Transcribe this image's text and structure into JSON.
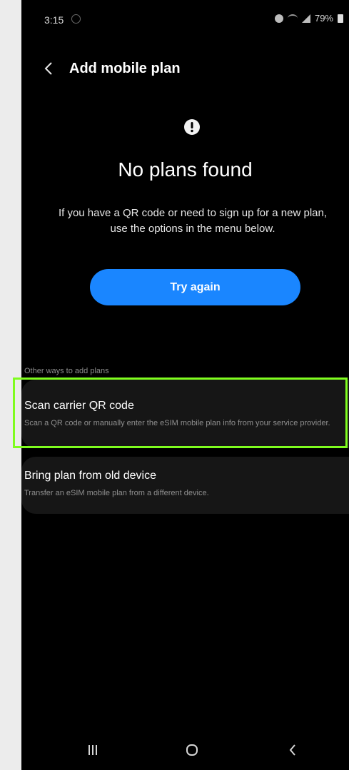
{
  "status_bar": {
    "time": "3:15",
    "battery": "79%"
  },
  "header": {
    "title": "Add mobile plan"
  },
  "main": {
    "headline": "No plans found",
    "description": "If you have a QR code or need to sign up for a new plan, use the options in the menu below.",
    "try_again_label": "Try again"
  },
  "other_ways": {
    "label": "Other ways to add plans",
    "items": [
      {
        "title": "Scan carrier QR code",
        "subtitle": "Scan a QR code or manually enter the eSIM mobile plan info from your service provider."
      },
      {
        "title": "Bring plan from old device",
        "subtitle": "Transfer an eSIM mobile plan from a different device."
      }
    ]
  },
  "colors": {
    "accent": "#1a86ff",
    "highlight": "#7ffc1f",
    "background": "#000000"
  },
  "icons": [
    "back-icon",
    "alert-icon",
    "recent-apps-icon",
    "home-icon",
    "nav-back-icon"
  ]
}
